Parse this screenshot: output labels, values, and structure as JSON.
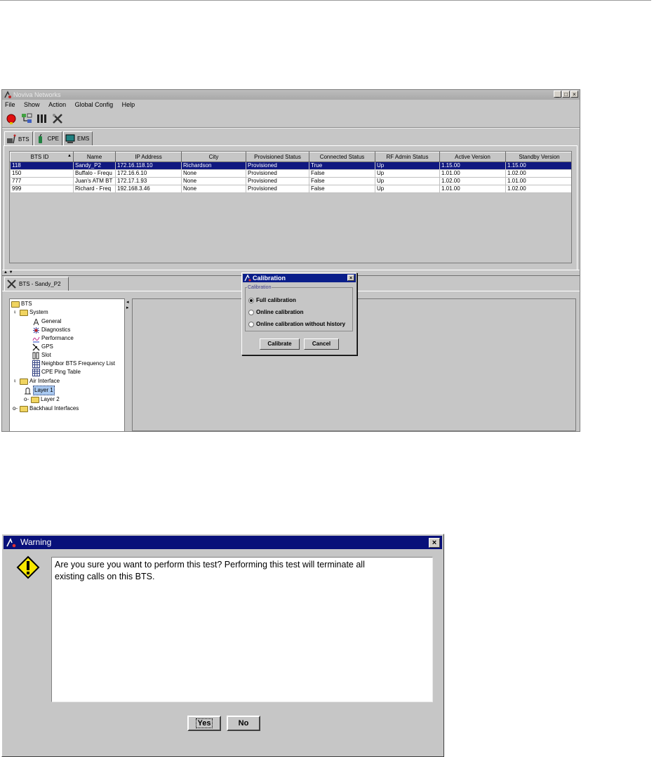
{
  "main_window": {
    "title": "Noviva Networks",
    "window_buttons": [
      "_",
      "□",
      "×"
    ],
    "menu": [
      "File",
      "Show",
      "Action",
      "Global Config",
      "Help"
    ],
    "toolbar_icons": [
      "alarm-icon",
      "network-icon",
      "bars-icon",
      "tools-icon"
    ],
    "tabs": [
      {
        "label": "BTS",
        "icon": "bts-icon"
      },
      {
        "label": "CPE",
        "icon": "cpe-icon"
      },
      {
        "label": "EMS",
        "icon": "ems-icon"
      }
    ],
    "table": {
      "columns": [
        "BTS ID",
        "Name",
        "IP Address",
        "City",
        "Provisioned Status",
        "Connected Status",
        "RF Admin Status",
        "Active Version",
        "Standby Version"
      ],
      "sort_indicator": "▲",
      "rows": [
        [
          "118",
          "Sandy_P2",
          "172.16.118.10",
          "Richardson",
          "Provisioned",
          "True",
          "Up",
          "1.15.00",
          "1.15.00"
        ],
        [
          "150",
          "Buffalo - Frequ",
          "172.16.6.10",
          "None",
          "Provisioned",
          "False",
          "Up",
          "1.01.00",
          "1.02.00"
        ],
        [
          "777",
          "Juan's ATM BT",
          "172.17.1.93",
          "None",
          "Provisioned",
          "False",
          "Up",
          "1.02.00",
          "1.01.00"
        ],
        [
          "999",
          "Richard - Freq",
          "192.168.3.46",
          "None",
          "Provisioned",
          "False",
          "Up",
          "1.01.00",
          "1.02.00"
        ]
      ],
      "selected_row": 0
    },
    "detail_tab": "BTS - Sandy_P2",
    "tree": {
      "root": "BTS",
      "system": "System",
      "system_items": [
        "General",
        "Diagnostics",
        "Performance",
        "GPS",
        "Slot",
        "Neighbor BTS Frequency List",
        "CPE Ping Table"
      ],
      "air_interface": "Air Interface",
      "layer1": "Layer 1",
      "layer2": "Layer 2",
      "backhaul": "Backhaul Interfaces"
    }
  },
  "calibration_dialog": {
    "title": "Calibration",
    "group_label": "Calibration",
    "options": [
      "Full calibration",
      "Online calibration",
      "Online calibration without history"
    ],
    "selected_option": 0,
    "calibrate_label": "Calibrate",
    "cancel_label": "Cancel"
  },
  "warning_dialog": {
    "title": "Warning",
    "message_line1": "Are you sure you want to perform this test? Performing this test will terminate all",
    "message_line2": "existing calls on this BTS.",
    "yes_label": "Yes",
    "no_label": "No"
  },
  "colors": {
    "selection": "#101880",
    "dialog_title": "#08107a",
    "window_bg": "#c6c6c6"
  }
}
